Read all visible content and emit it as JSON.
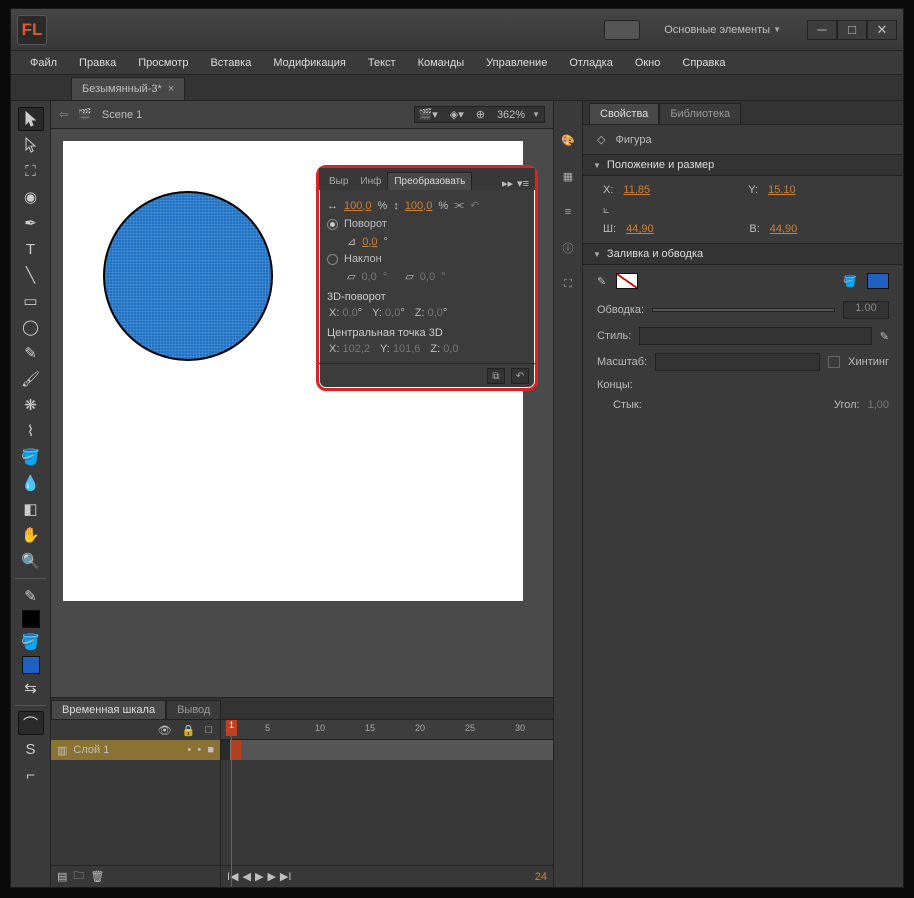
{
  "app": {
    "logo": "FL",
    "workspace": "Основные элементы"
  },
  "menu": {
    "file": "Файл",
    "edit": "Правка",
    "view": "Просмотр",
    "insert": "Вставка",
    "modify": "Модификация",
    "text": "Текст",
    "commands": "Команды",
    "control": "Управление",
    "debug": "Отладка",
    "window": "Окно",
    "help": "Справка"
  },
  "doc": {
    "tab": "Безымянный-3*",
    "scene": "Scene 1",
    "zoom": "362%"
  },
  "timeline": {
    "tab1": "Временная шкала",
    "tab2": "Вывод",
    "layer": "Слой 1",
    "ticks": [
      "1",
      "5",
      "10",
      "15",
      "20",
      "25",
      "30"
    ],
    "cur": "1",
    "total": "24"
  },
  "props": {
    "tab1": "Свойства",
    "tab2": "Библиотека",
    "objtype": "Фигура",
    "sec_pos": "Положение и размер",
    "x_lbl": "X:",
    "x": "11,85",
    "y_lbl": "Y:",
    "y": "15,10",
    "w_lbl": "Ш:",
    "w": "44,90",
    "h_lbl": "В:",
    "h": "44,90",
    "sec_fill": "Заливка и обводка",
    "stroke_lbl": "Обводка:",
    "stroke_val": "1.00",
    "style_lbl": "Стиль:",
    "scale_lbl": "Масштаб:",
    "hint_lbl": "Хинтинг",
    "caps_lbl": "Концы:",
    "join_lbl": "Стык:",
    "angle_lbl": "Угол:",
    "angle": "1,00"
  },
  "xform": {
    "tab1": "Выр",
    "tab2": "Инф",
    "tab3": "Преобразовать",
    "sx": "100,0",
    "sy": "100,0",
    "pct": "%",
    "rotate": "Поворот",
    "rot_val": "0,0",
    "deg": "°",
    "skew": "Наклон",
    "skx": "0,0",
    "sky": "0,0",
    "rot3d": "3D-поворот",
    "x": "X:",
    "y": "Y:",
    "z": "Z:",
    "rx": "0,0",
    "ry": "0,0",
    "rz": "0,0",
    "center3d": "Центральная точка 3D",
    "cx": "102,2",
    "cy": "101,6",
    "cz": "0,0"
  }
}
